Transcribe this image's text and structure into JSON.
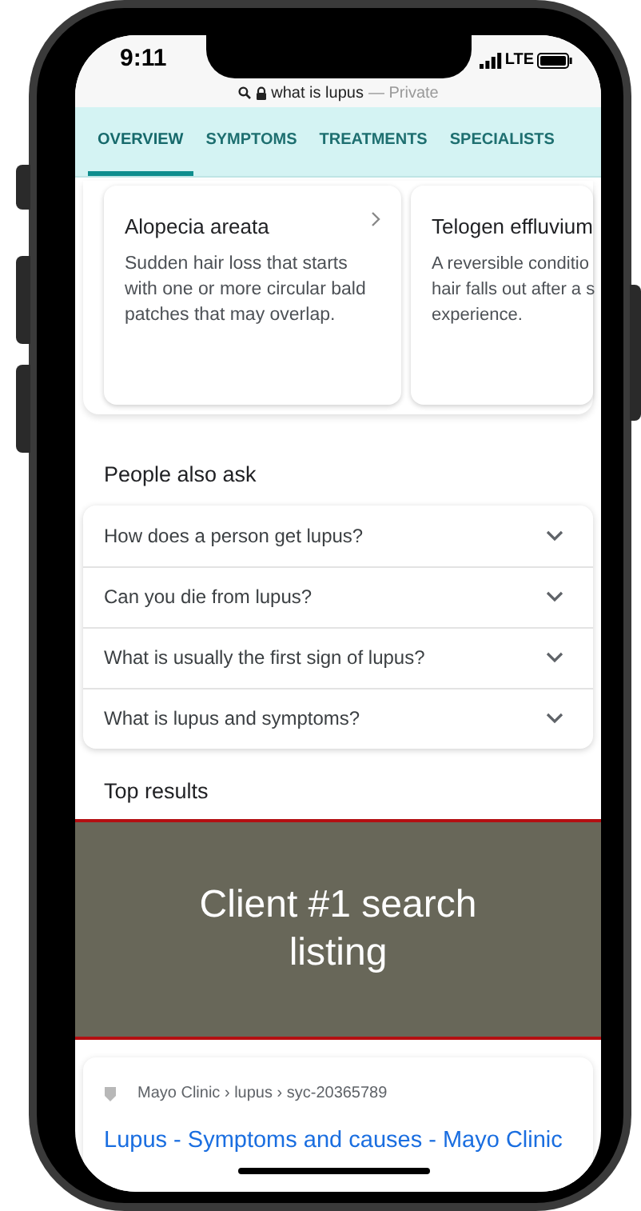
{
  "status_bar": {
    "time": "9:11",
    "network": "LTE"
  },
  "address_bar": {
    "query": "what is lupus",
    "mode": "— Private"
  },
  "tabs": [
    {
      "label": "OVERVIEW",
      "selected": true
    },
    {
      "label": "SYMPTOMS",
      "selected": false
    },
    {
      "label": "TREATMENTS",
      "selected": false
    },
    {
      "label": "SPECIALISTS",
      "selected": false
    }
  ],
  "cards": [
    {
      "title": "Alopecia areata",
      "lines": [
        "Sudden hair loss that starts",
        "with one or more circular bald",
        "patches that may overlap."
      ],
      "chevron": true
    },
    {
      "title": "Telogen effluvium",
      "lines": [
        "A reversible conditio",
        "hair falls out after a s",
        "experience."
      ]
    }
  ],
  "people_also_ask": {
    "title": "People also ask",
    "questions": [
      {
        "text": "How does a person get lupus?",
        "expanded": false
      },
      {
        "text": "Can you die from lupus?",
        "expanded": false
      },
      {
        "text": "What is usually the first sign of lupus?",
        "expanded": false
      },
      {
        "text": "What is lupus and symptoms?",
        "expanded": false
      }
    ]
  },
  "top_results": {
    "title": "Top results"
  },
  "placeholder_block": {
    "text": "Client #1 search listing"
  },
  "result": {
    "breadcrumb": "Mayo Clinic › lupus › syc-20365789",
    "title": "Lupus - Symptoms and causes - Mayo Clinic"
  }
}
